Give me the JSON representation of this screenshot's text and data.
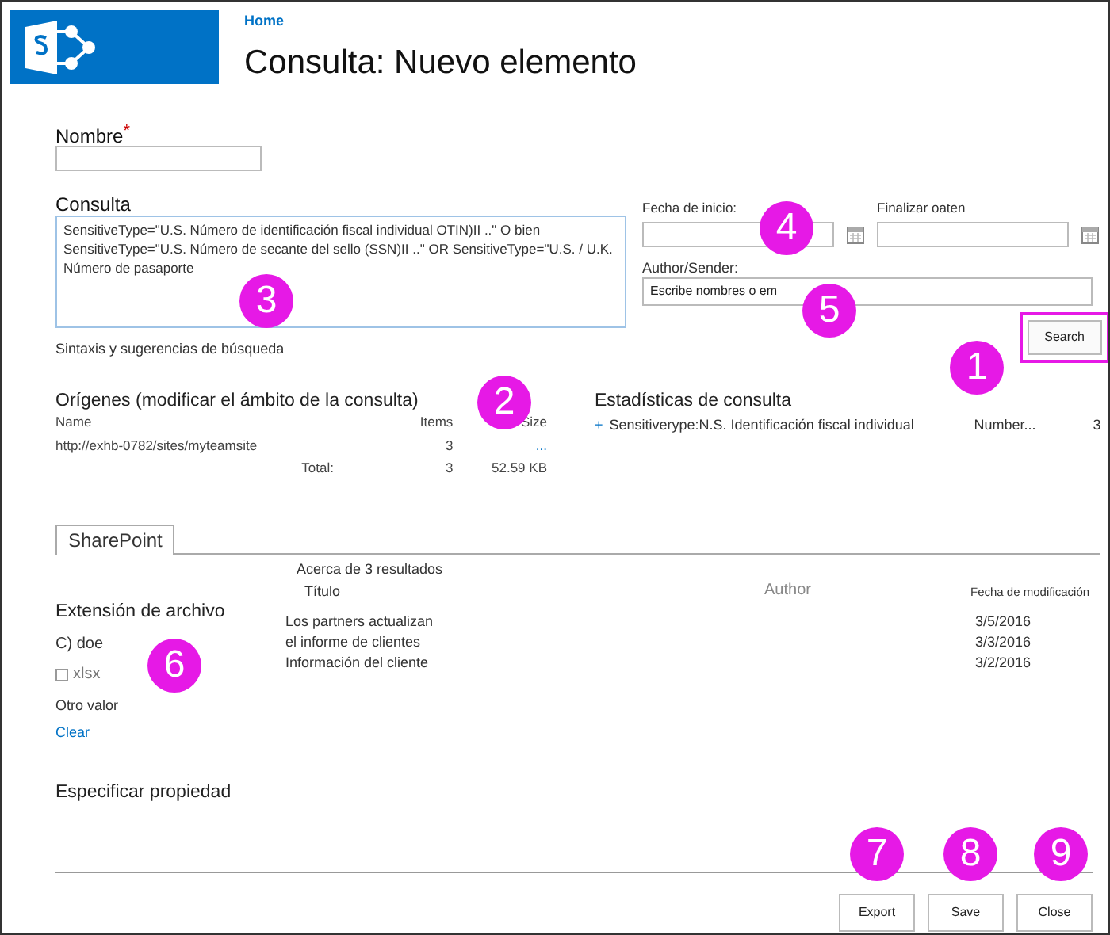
{
  "header": {
    "breadcrumb": "Home",
    "title": "Consulta: Nuevo elemento"
  },
  "name_field": {
    "label": "Nombre",
    "required_mark": "*"
  },
  "query": {
    "label": "Consulta",
    "lines": [
      "SensitiveType=\"U.S. Número de identificación fiscal individual OTIN)II ..\" O bien",
      "SensitiveType=\"U.S. Número de secante del sello (SSN)II ..\" OR SensitiveType=\"U.S. / U.K.",
      "Número de pasaporte"
    ],
    "help_link": "Sintaxis y sugerencias de búsqueda"
  },
  "dates": [
    {
      "label": "Fecha de inicio:"
    },
    {
      "label": "Finalizar oaten"
    }
  ],
  "author": {
    "label": "Author/Sender:",
    "placeholder": "Escribe nombres o em"
  },
  "search_button": "Search",
  "sources": {
    "title": "Orígenes (modificar el ámbito de la consulta)",
    "columns": [
      "Name",
      "Items",
      "Size"
    ],
    "rows": [
      {
        "name": "http://exhb-0782/sites/myteamsite",
        "items": "3",
        "size": "..."
      }
    ],
    "total": {
      "label": "Total:",
      "items": "3",
      "size": "52.59 KB"
    }
  },
  "stats": {
    "title": "Estadísticas de consulta",
    "expander": "+",
    "rows": [
      {
        "label": "Sensitiverype:N.S. Identificación fiscal individual",
        "type": "Number...",
        "count": "3"
      }
    ]
  },
  "tabs": [
    {
      "label": "SharePoint",
      "selected": true
    }
  ],
  "refiners": {
    "title": "Extensión de archivo",
    "items": [
      {
        "kind": "text",
        "label": "C) doe"
      },
      {
        "kind": "checkbox",
        "label": "xlsx",
        "checked": false
      }
    ],
    "other": "Otro valor",
    "clear": "Clear"
  },
  "results": {
    "summary": "Acerca de 3 resultados",
    "columns": [
      "Título",
      "Author",
      "Fecha de modificación"
    ],
    "rows": [
      {
        "title": "Los partners actualizan",
        "date": "3/5/2016"
      },
      {
        "title": "el informe de clientes",
        "date": "3/3/2016"
      },
      {
        "title": "Información del cliente",
        "date": "3/2/2016"
      }
    ]
  },
  "specify_property": "Especificar propiedad",
  "buttons": [
    "Export",
    "Save",
    "Close"
  ],
  "callouts": [
    "1",
    "2",
    "3",
    "4",
    "5",
    "6",
    "7",
    "8",
    "9"
  ]
}
